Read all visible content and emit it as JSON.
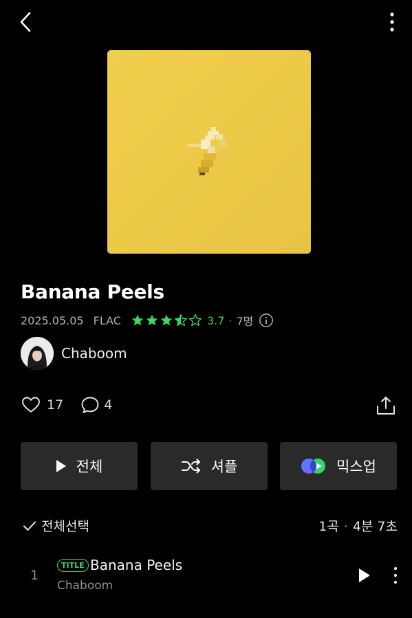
{
  "header": {
    "back_icon": "chevron-left-icon",
    "more_icon": "vertical-dots-icon"
  },
  "album": {
    "title": "Banana Peels",
    "release_date": "2025.05.05",
    "format": "FLAC",
    "rating_stars": 3.5,
    "rating_value": "3.7",
    "rating_separator": "·",
    "rating_count": "7명",
    "accent_color": "#3fd36a",
    "cover_color": "#eecb4a"
  },
  "artist": {
    "name": "Chaboom"
  },
  "social": {
    "likes": "17",
    "comments": "4"
  },
  "actions": {
    "play_all": "전체",
    "shuffle": "셔플",
    "mixup": "믹스업"
  },
  "list": {
    "select_all": "전체선택",
    "track_count": "1곡",
    "separator": "·",
    "duration": "4분 7초"
  },
  "tracks": [
    {
      "number": "1",
      "badge": "TITLE",
      "title": "Banana Peels",
      "artist": "Chaboom"
    }
  ]
}
